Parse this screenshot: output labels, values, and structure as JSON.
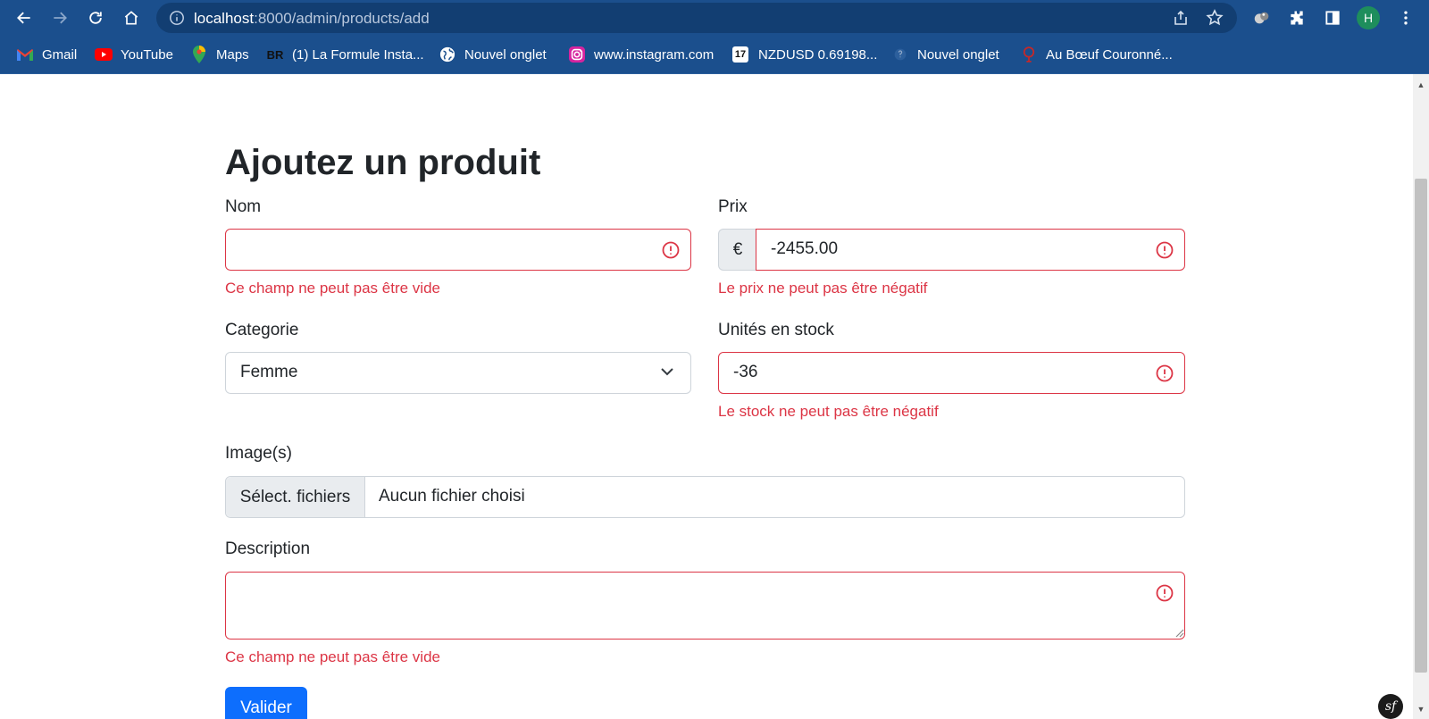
{
  "browser": {
    "url_host": "localhost",
    "url_path": ":8000/admin/products/add",
    "avatar_letter": "H",
    "bookmarks": [
      {
        "label": "Gmail",
        "icon": "gmail-icon",
        "color": "#ea4335"
      },
      {
        "label": "YouTube",
        "icon": "youtube-icon",
        "color": "#ff0000"
      },
      {
        "label": "Maps",
        "icon": "maps-icon",
        "color": "#34a853"
      },
      {
        "label": "(1) La Formule Insta...",
        "icon": "br-icon",
        "icon_text": "BR"
      },
      {
        "label": "Nouvel onglet",
        "icon": "globe-icon"
      },
      {
        "label": "www.instagram.com",
        "icon": "instagram-icon",
        "color": "#e1306c"
      },
      {
        "label": "NZDUSD 0.69198...",
        "icon": "tradingview-icon",
        "icon_text": "17"
      },
      {
        "label": "Nouvel onglet",
        "icon": "tab-icon"
      },
      {
        "label": "Au Bœuf Couronné...",
        "icon": "restaurant-icon",
        "color": "#c62828"
      }
    ]
  },
  "form": {
    "title": "Ajoutez un produit",
    "name": {
      "label": "Nom",
      "value": "",
      "error": "Ce champ ne peut pas être vide"
    },
    "price": {
      "label": "Prix",
      "prefix": "€",
      "value": "-2455.00",
      "error": "Le prix ne peut pas être négatif"
    },
    "category": {
      "label": "Categorie",
      "selected": "Femme"
    },
    "stock": {
      "label": "Unités en stock",
      "value": "-36",
      "error": "Le stock ne peut pas être négatif"
    },
    "images": {
      "label": "Image(s)",
      "button": "Sélect. fichiers",
      "status": "Aucun fichier choisi"
    },
    "description": {
      "label": "Description",
      "value": "",
      "error": "Ce champ ne peut pas être vide"
    },
    "submit": "Valider"
  },
  "colors": {
    "chrome": "#1b4f8d",
    "error": "#dc3545",
    "primary": "#0d6efd"
  },
  "debug_badge": "sf"
}
